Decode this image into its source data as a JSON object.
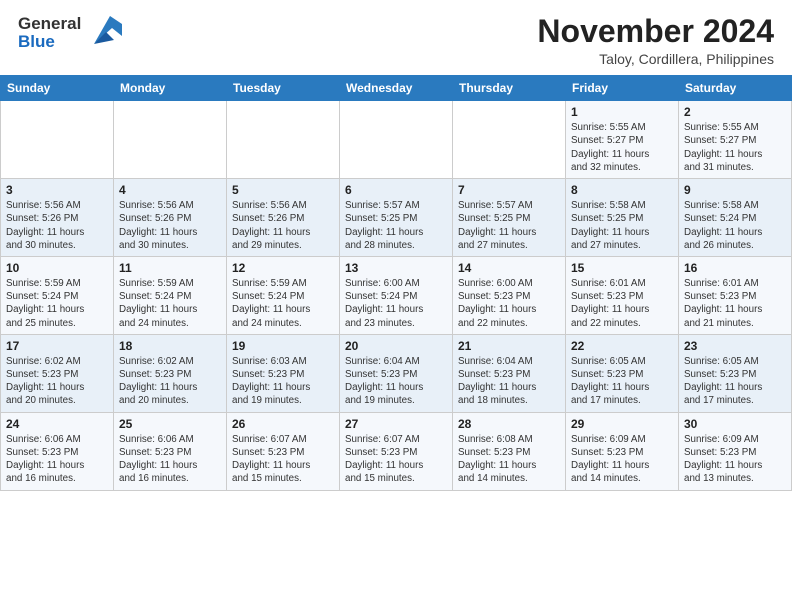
{
  "header": {
    "logo": {
      "line1": "General",
      "line2": "Blue"
    },
    "month_year": "November 2024",
    "location": "Taloy, Cordillera, Philippines"
  },
  "weekdays": [
    "Sunday",
    "Monday",
    "Tuesday",
    "Wednesday",
    "Thursday",
    "Friday",
    "Saturday"
  ],
  "weeks": [
    [
      {
        "day": "",
        "info": ""
      },
      {
        "day": "",
        "info": ""
      },
      {
        "day": "",
        "info": ""
      },
      {
        "day": "",
        "info": ""
      },
      {
        "day": "",
        "info": ""
      },
      {
        "day": "1",
        "info": "Sunrise: 5:55 AM\nSunset: 5:27 PM\nDaylight: 11 hours\nand 32 minutes."
      },
      {
        "day": "2",
        "info": "Sunrise: 5:55 AM\nSunset: 5:27 PM\nDaylight: 11 hours\nand 31 minutes."
      }
    ],
    [
      {
        "day": "3",
        "info": "Sunrise: 5:56 AM\nSunset: 5:26 PM\nDaylight: 11 hours\nand 30 minutes."
      },
      {
        "day": "4",
        "info": "Sunrise: 5:56 AM\nSunset: 5:26 PM\nDaylight: 11 hours\nand 30 minutes."
      },
      {
        "day": "5",
        "info": "Sunrise: 5:56 AM\nSunset: 5:26 PM\nDaylight: 11 hours\nand 29 minutes."
      },
      {
        "day": "6",
        "info": "Sunrise: 5:57 AM\nSunset: 5:25 PM\nDaylight: 11 hours\nand 28 minutes."
      },
      {
        "day": "7",
        "info": "Sunrise: 5:57 AM\nSunset: 5:25 PM\nDaylight: 11 hours\nand 27 minutes."
      },
      {
        "day": "8",
        "info": "Sunrise: 5:58 AM\nSunset: 5:25 PM\nDaylight: 11 hours\nand 27 minutes."
      },
      {
        "day": "9",
        "info": "Sunrise: 5:58 AM\nSunset: 5:24 PM\nDaylight: 11 hours\nand 26 minutes."
      }
    ],
    [
      {
        "day": "10",
        "info": "Sunrise: 5:59 AM\nSunset: 5:24 PM\nDaylight: 11 hours\nand 25 minutes."
      },
      {
        "day": "11",
        "info": "Sunrise: 5:59 AM\nSunset: 5:24 PM\nDaylight: 11 hours\nand 24 minutes."
      },
      {
        "day": "12",
        "info": "Sunrise: 5:59 AM\nSunset: 5:24 PM\nDaylight: 11 hours\nand 24 minutes."
      },
      {
        "day": "13",
        "info": "Sunrise: 6:00 AM\nSunset: 5:24 PM\nDaylight: 11 hours\nand 23 minutes."
      },
      {
        "day": "14",
        "info": "Sunrise: 6:00 AM\nSunset: 5:23 PM\nDaylight: 11 hours\nand 22 minutes."
      },
      {
        "day": "15",
        "info": "Sunrise: 6:01 AM\nSunset: 5:23 PM\nDaylight: 11 hours\nand 22 minutes."
      },
      {
        "day": "16",
        "info": "Sunrise: 6:01 AM\nSunset: 5:23 PM\nDaylight: 11 hours\nand 21 minutes."
      }
    ],
    [
      {
        "day": "17",
        "info": "Sunrise: 6:02 AM\nSunset: 5:23 PM\nDaylight: 11 hours\nand 20 minutes."
      },
      {
        "day": "18",
        "info": "Sunrise: 6:02 AM\nSunset: 5:23 PM\nDaylight: 11 hours\nand 20 minutes."
      },
      {
        "day": "19",
        "info": "Sunrise: 6:03 AM\nSunset: 5:23 PM\nDaylight: 11 hours\nand 19 minutes."
      },
      {
        "day": "20",
        "info": "Sunrise: 6:04 AM\nSunset: 5:23 PM\nDaylight: 11 hours\nand 19 minutes."
      },
      {
        "day": "21",
        "info": "Sunrise: 6:04 AM\nSunset: 5:23 PM\nDaylight: 11 hours\nand 18 minutes."
      },
      {
        "day": "22",
        "info": "Sunrise: 6:05 AM\nSunset: 5:23 PM\nDaylight: 11 hours\nand 17 minutes."
      },
      {
        "day": "23",
        "info": "Sunrise: 6:05 AM\nSunset: 5:23 PM\nDaylight: 11 hours\nand 17 minutes."
      }
    ],
    [
      {
        "day": "24",
        "info": "Sunrise: 6:06 AM\nSunset: 5:23 PM\nDaylight: 11 hours\nand 16 minutes."
      },
      {
        "day": "25",
        "info": "Sunrise: 6:06 AM\nSunset: 5:23 PM\nDaylight: 11 hours\nand 16 minutes."
      },
      {
        "day": "26",
        "info": "Sunrise: 6:07 AM\nSunset: 5:23 PM\nDaylight: 11 hours\nand 15 minutes."
      },
      {
        "day": "27",
        "info": "Sunrise: 6:07 AM\nSunset: 5:23 PM\nDaylight: 11 hours\nand 15 minutes."
      },
      {
        "day": "28",
        "info": "Sunrise: 6:08 AM\nSunset: 5:23 PM\nDaylight: 11 hours\nand 14 minutes."
      },
      {
        "day": "29",
        "info": "Sunrise: 6:09 AM\nSunset: 5:23 PM\nDaylight: 11 hours\nand 14 minutes."
      },
      {
        "day": "30",
        "info": "Sunrise: 6:09 AM\nSunset: 5:23 PM\nDaylight: 11 hours\nand 13 minutes."
      }
    ]
  ]
}
